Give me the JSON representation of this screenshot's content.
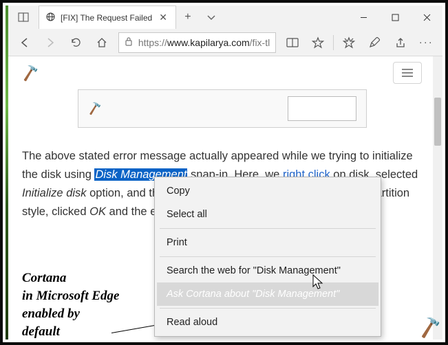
{
  "titlebar": {
    "tab_title": "[FIX] The Request Failed"
  },
  "addressbar": {
    "protocol": "https://",
    "host": "www.kapilarya.com",
    "path": "/fix-tl"
  },
  "article": {
    "p1_part1": "The above stated error message actually appeared while we trying to initialize the disk using ",
    "p1_sel": "Disk Management",
    "p1_part2": " snap-in. Here, we ",
    "p1_link": "right click",
    "p1_part3": " on disk, selected ",
    "p1_ital1": "Initialize disk",
    "p1_part4": " option, and then choo",
    "p1_part5": " partition style, clicked ",
    "p1_ital2": "OK",
    "p1_part6": " and the error su"
  },
  "annotation": {
    "l1": "Cortana",
    "l2": "in Microsoft Edge",
    "l3": "enabled by",
    "l4": "default"
  },
  "context_menu": {
    "items": [
      "Copy",
      "Select all",
      "Print",
      "Search the web for \"Disk Management\"",
      "Ask Cortana about \"Disk Management\"",
      "Read aloud"
    ],
    "selected_index": 4
  }
}
